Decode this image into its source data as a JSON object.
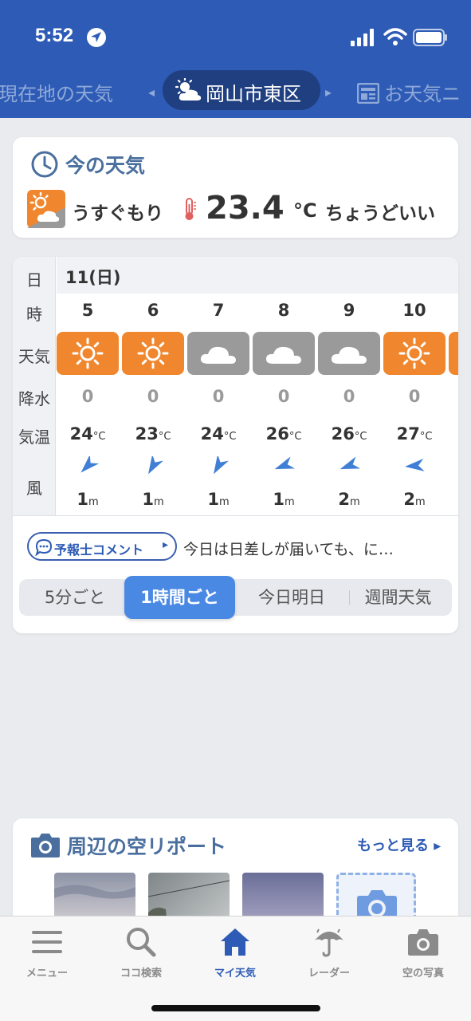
{
  "status_bar": {
    "time": "5:52"
  },
  "header": {
    "tabs": [
      {
        "label": "現在地の天気"
      },
      {
        "label": "岡山市東区"
      },
      {
        "label": "お天気ニ"
      }
    ]
  },
  "now": {
    "title": "今の天気",
    "condition": "うすぐもり",
    "temperature": "23.4",
    "unit": "°C",
    "feeling": "ちょうどいい"
  },
  "forecast": {
    "labels": {
      "date": "日",
      "hour": "時",
      "weather": "天気",
      "precip": "降水",
      "temp": "気温",
      "wind": "風"
    },
    "date": "11(日)",
    "temp_unit": "°C",
    "wind_unit": "m",
    "hours": [
      {
        "hour": "5",
        "weather": "sunny",
        "precip": "0",
        "temp": "24",
        "wind_speed": "1",
        "wind_dir_deg": 45
      },
      {
        "hour": "6",
        "weather": "sunny",
        "precip": "0",
        "temp": "23",
        "wind_speed": "1",
        "wind_dir_deg": 30
      },
      {
        "hour": "7",
        "weather": "cloudy",
        "precip": "0",
        "temp": "24",
        "wind_speed": "1",
        "wind_dir_deg": 30
      },
      {
        "hour": "8",
        "weather": "cloudy",
        "precip": "0",
        "temp": "26",
        "wind_speed": "1",
        "wind_dir_deg": 70
      },
      {
        "hour": "9",
        "weather": "cloudy",
        "precip": "0",
        "temp": "26",
        "wind_speed": "2",
        "wind_dir_deg": 70
      },
      {
        "hour": "10",
        "weather": "sunny",
        "precip": "0",
        "temp": "27",
        "wind_speed": "2",
        "wind_dir_deg": 85
      }
    ],
    "comment_button": "予報士コメント",
    "comment_text": "今日は日差しが届いても、に…",
    "segments": [
      "5分ごと",
      "1時間ごと",
      "今日明日",
      "週間天気"
    ],
    "active_segment": "1時間ごと"
  },
  "sky_report": {
    "title": "周辺の空リポート",
    "more": "もっと見る"
  },
  "bottom_nav": [
    {
      "label": "メニュー",
      "icon": "menu-icon"
    },
    {
      "label": "ココ検索",
      "icon": "search-icon"
    },
    {
      "label": "マイ天気",
      "icon": "home-icon"
    },
    {
      "label": "レーダー",
      "icon": "umbrella-icon"
    },
    {
      "label": "空の写真",
      "icon": "camera-icon"
    }
  ],
  "colors": {
    "header": "#2d5bb5",
    "sunny_box": "#f0872e",
    "cloudy_box": "#9a9a9a",
    "active_segment": "#4a89e3",
    "title": "#4a6f9e"
  }
}
